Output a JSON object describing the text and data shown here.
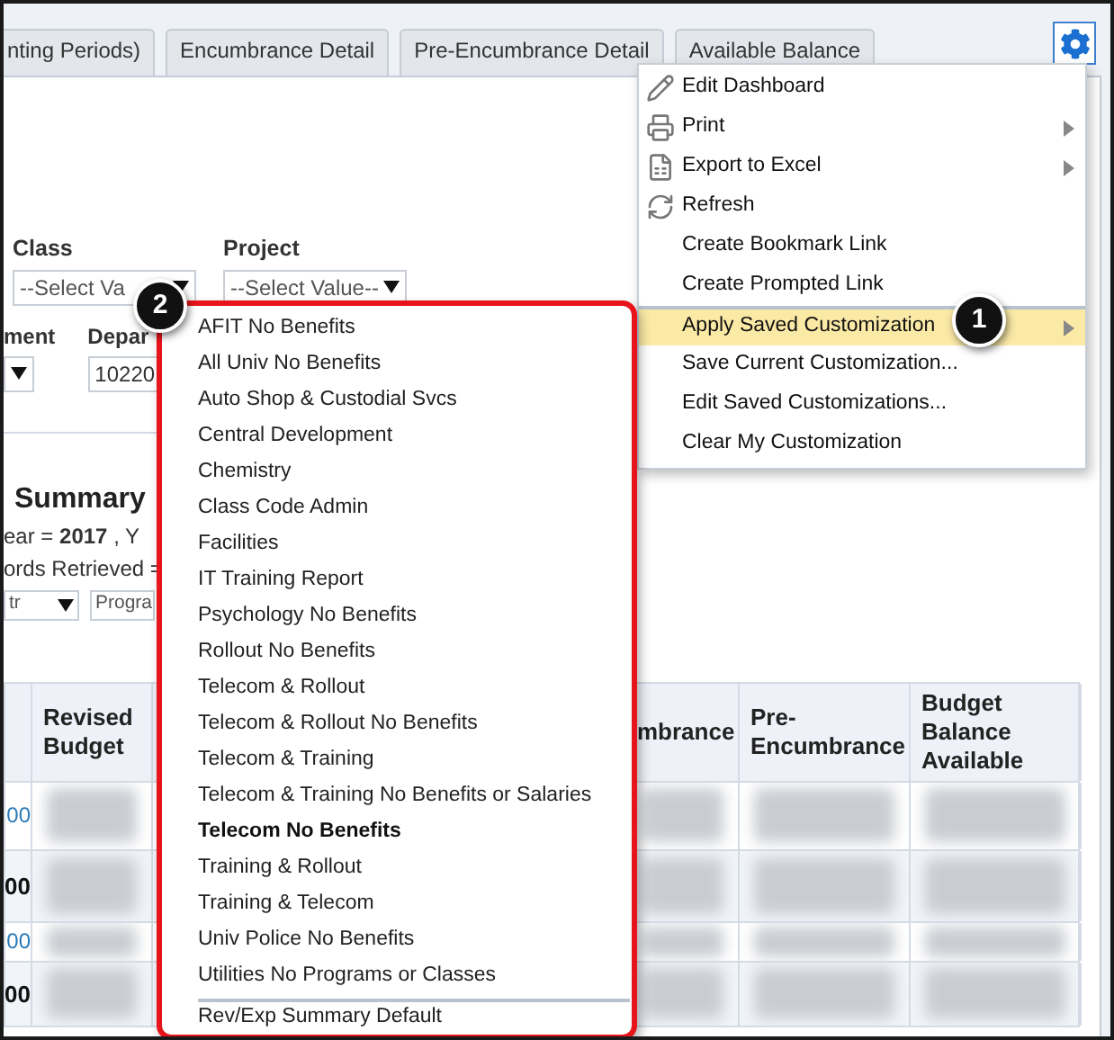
{
  "tabs": [
    {
      "label": "nting Periods)",
      "selected": false
    },
    {
      "label": "Encumbrance Detail",
      "selected": false
    },
    {
      "label": "Pre-Encumbrance Detail",
      "selected": false
    },
    {
      "label": "Available Balance",
      "selected": false
    }
  ],
  "prompts": {
    "row_1": [
      {
        "label": "Class",
        "value": "--Select Va"
      },
      {
        "label": "Project",
        "value": "--Select Value--"
      }
    ],
    "row_2": [
      {
        "label": "ment"
      },
      {
        "label": "Depar",
        "value": "10220"
      }
    ]
  },
  "report": {
    "title": "Summary",
    "filter_line": "ear = **2017** , Y",
    "records_line": "ords Retrieved =",
    "selects": [
      "tr",
      "Progra"
    ]
  },
  "table": {
    "columns": [
      "",
      "Revised Budget",
      "",
      "mbrance",
      "Pre-Encumbrance",
      "Budget Balance Available"
    ],
    "rows": [
      {
        "column_1": "00",
        "kind": "link"
      },
      {
        "column_1": "00",
        "kind": "total"
      },
      {
        "column_1": "00",
        "kind": "link"
      },
      {
        "column_1": "00",
        "kind": "total"
      }
    ]
  },
  "menu": {
    "items": [
      {
        "label": "Edit Dashboard",
        "submenu": false,
        "selected": false,
        "separator_before": false
      },
      {
        "label": "Print",
        "submenu": true,
        "selected": false,
        "separator_before": false
      },
      {
        "label": "Export to Excel",
        "submenu": true,
        "selected": false,
        "separator_before": false
      },
      {
        "label": "Refresh",
        "submenu": false,
        "selected": false,
        "separator_before": false
      },
      {
        "label": "Create Bookmark Link",
        "submenu": false,
        "selected": false,
        "separator_before": false
      },
      {
        "label": "Create Prompted Link",
        "submenu": false,
        "selected": false,
        "separator_before": false
      },
      {
        "label": "Apply Saved Customization",
        "submenu": true,
        "selected": true,
        "separator_before": true
      },
      {
        "label": "Save Current Customization...",
        "submenu": false,
        "selected": false,
        "separator_before": false
      },
      {
        "label": "Edit Saved Customizations...",
        "submenu": false,
        "selected": false,
        "separator_before": false
      },
      {
        "label": "Clear My Customization",
        "submenu": false,
        "selected": false,
        "separator_before": false
      }
    ]
  },
  "submenu": {
    "items": [
      {
        "label": "AFIT No Benefits",
        "current": false,
        "separator_before": false
      },
      {
        "label": "All Univ No Benefits",
        "current": false,
        "separator_before": false
      },
      {
        "label": "Auto Shop & Custodial Svcs",
        "current": false,
        "separator_before": false
      },
      {
        "label": "Central Development",
        "current": false,
        "separator_before": false
      },
      {
        "label": "Chemistry",
        "current": false,
        "separator_before": false
      },
      {
        "label": "Class Code Admin",
        "current": false,
        "separator_before": false
      },
      {
        "label": "Facilities",
        "current": false,
        "separator_before": false
      },
      {
        "label": "IT Training Report",
        "current": false,
        "separator_before": false
      },
      {
        "label": "Psychology No Benefits",
        "current": false,
        "separator_before": false
      },
      {
        "label": "Rollout No Benefits",
        "current": false,
        "separator_before": false
      },
      {
        "label": "Telecom & Rollout",
        "current": false,
        "separator_before": false
      },
      {
        "label": "Telecom & Rollout No Benefits",
        "current": false,
        "separator_before": false
      },
      {
        "label": "Telecom & Training",
        "current": false,
        "separator_before": false
      },
      {
        "label": "Telecom & Training No Benefits or Salaries",
        "current": false,
        "separator_before": false
      },
      {
        "label": "Telecom No Benefits",
        "current": true,
        "separator_before": false
      },
      {
        "label": "Training & Rollout",
        "current": false,
        "separator_before": false
      },
      {
        "label": "Training & Telecom",
        "current": false,
        "separator_before": false
      },
      {
        "label": "Univ Police No Benefits",
        "current": false,
        "separator_before": false
      },
      {
        "label": "Utilities No Programs or Classes",
        "current": false,
        "separator_before": false
      },
      {
        "label": "Rev/Exp Summary Default",
        "current": false,
        "separator_before": true
      }
    ]
  },
  "callouts": [
    "1",
    "2"
  ]
}
